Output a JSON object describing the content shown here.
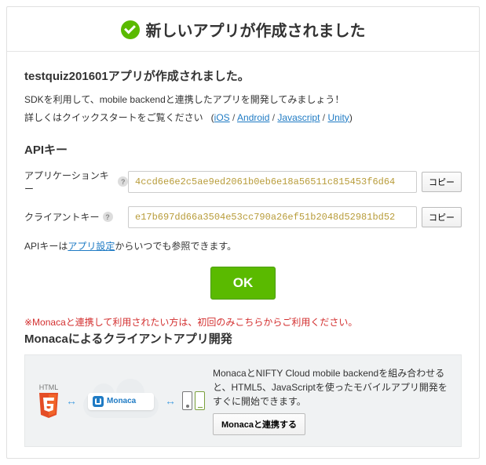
{
  "header": {
    "title": "新しいアプリが作成されました"
  },
  "app": {
    "name": "testquiz201601",
    "created_suffix": "アプリが作成されました。"
  },
  "sdk": {
    "line1": "SDKを利用して、mobile backendと連携したアプリを開発してみましょう！",
    "line2_prefix": "詳しくはクイックスタートをご覧ください",
    "links": {
      "ios": "iOS",
      "android": "Android",
      "javascript": "Javascript",
      "unity": "Unity"
    }
  },
  "api": {
    "section_title": "APIキー",
    "app_key_label": "アプリケーションキー",
    "app_key_value": "4ccd6e6e2c5ae9ed2061b0eb6e18a56511c815453f6d64",
    "client_key_label": "クライアントキー",
    "client_key_value": "e17b697dd66a3504e53cc790a26ef51b2048d52981bd52",
    "copy_label": "コピー",
    "note_prefix": "APIキーは",
    "note_link": "アプリ設定",
    "note_suffix": "からいつでも参照できます。"
  },
  "ok_label": "OK",
  "monaca": {
    "warning": "※Monacaと連携して利用されたい方は、初回のみこちらからご利用ください。",
    "title": "Monacaによるクライアントアプリ開発",
    "html5_label": "HTML",
    "pill_label": "Monaca",
    "description": "MonacaとNIFTY Cloud mobile backendを組み合わせると、HTML5、JavaScriptを使ったモバイルアプリ開発をすぐに開始できます。",
    "button_label": "Monacaと連携する"
  },
  "icons": {
    "check": "check-circle-icon",
    "help": "help-icon",
    "arrow": "arrow-right-icon",
    "html5": "html5-icon",
    "monaca": "monaca-icon",
    "iphone": "iphone-icon",
    "android": "android-icon"
  }
}
